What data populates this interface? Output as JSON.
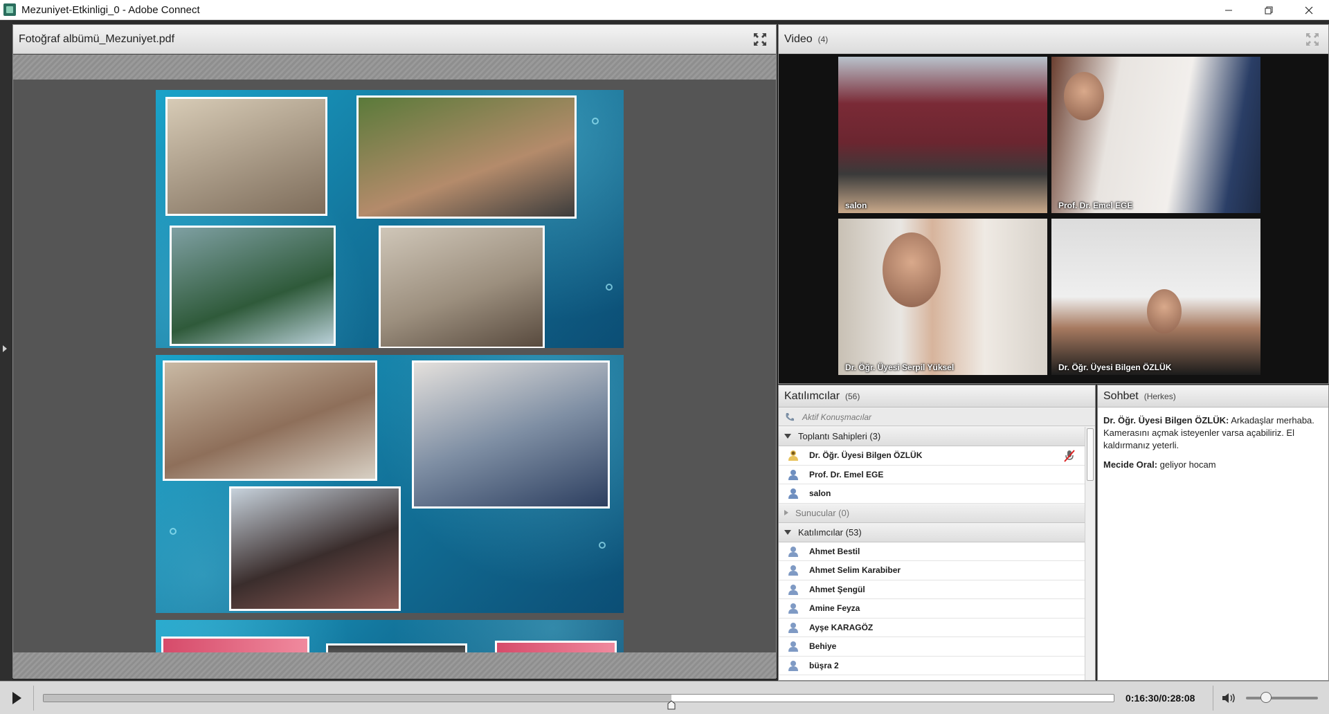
{
  "window": {
    "title": "Mezuniyet-Etkinligi_0 - Adobe Connect",
    "controls": [
      "minimize",
      "restore",
      "close"
    ]
  },
  "share_pod": {
    "title": "Fotoğraf albümü_Mezuniyet.pdf"
  },
  "video_pod": {
    "title": "Video",
    "count": "(4)",
    "tiles": [
      {
        "label": "salon"
      },
      {
        "label": "Prof. Dr. Emel EGE"
      },
      {
        "label": "Dr. Öğr. Üyesi Serpil Yüksel"
      },
      {
        "label": "Dr. Öğr. Üyesi Bilgen ÖZLÜK"
      }
    ]
  },
  "attendees_pod": {
    "title": "Katılımcılar",
    "count": "(56)",
    "active_speakers": "Aktif Konuşmacılar",
    "groups": {
      "hosts": {
        "label": "Toplantı Sahipleri (3)",
        "members": [
          "Dr. Öğr. Üyesi Bilgen ÖZLÜK",
          "Prof. Dr. Emel EGE",
          "salon"
        ]
      },
      "presenters": {
        "label": "Sunucular (0)"
      },
      "participants": {
        "label": "Katılımcılar (53)",
        "members": [
          "Ahmet Bestil",
          "Ahmet Selim Karabiber",
          "Ahmet Şengül",
          "Amine Feyza",
          "Ayşe KARAGÖZ",
          "Behiye",
          "büşra 2"
        ]
      }
    }
  },
  "chat_pod": {
    "title": "Sohbet",
    "scope": "(Herkes)",
    "messages": [
      {
        "sender": "Dr. Öğr. Üyesi Bilgen ÖZLÜK:",
        "text": "Arkadaşlar merhaba. Kamerasını açmak isteyenler varsa açabiliriz. El kaldırmanız yeterli."
      },
      {
        "sender": "Mecide Oral:",
        "text": "geliyor hocam"
      }
    ]
  },
  "playbar": {
    "timecode": "0:16:30/0:28:08",
    "progress_fraction": 0.5865,
    "volume_fraction": 0.28
  },
  "colors": {
    "slide_accent": "#13779e",
    "pod_header": "#dcdcdc"
  }
}
